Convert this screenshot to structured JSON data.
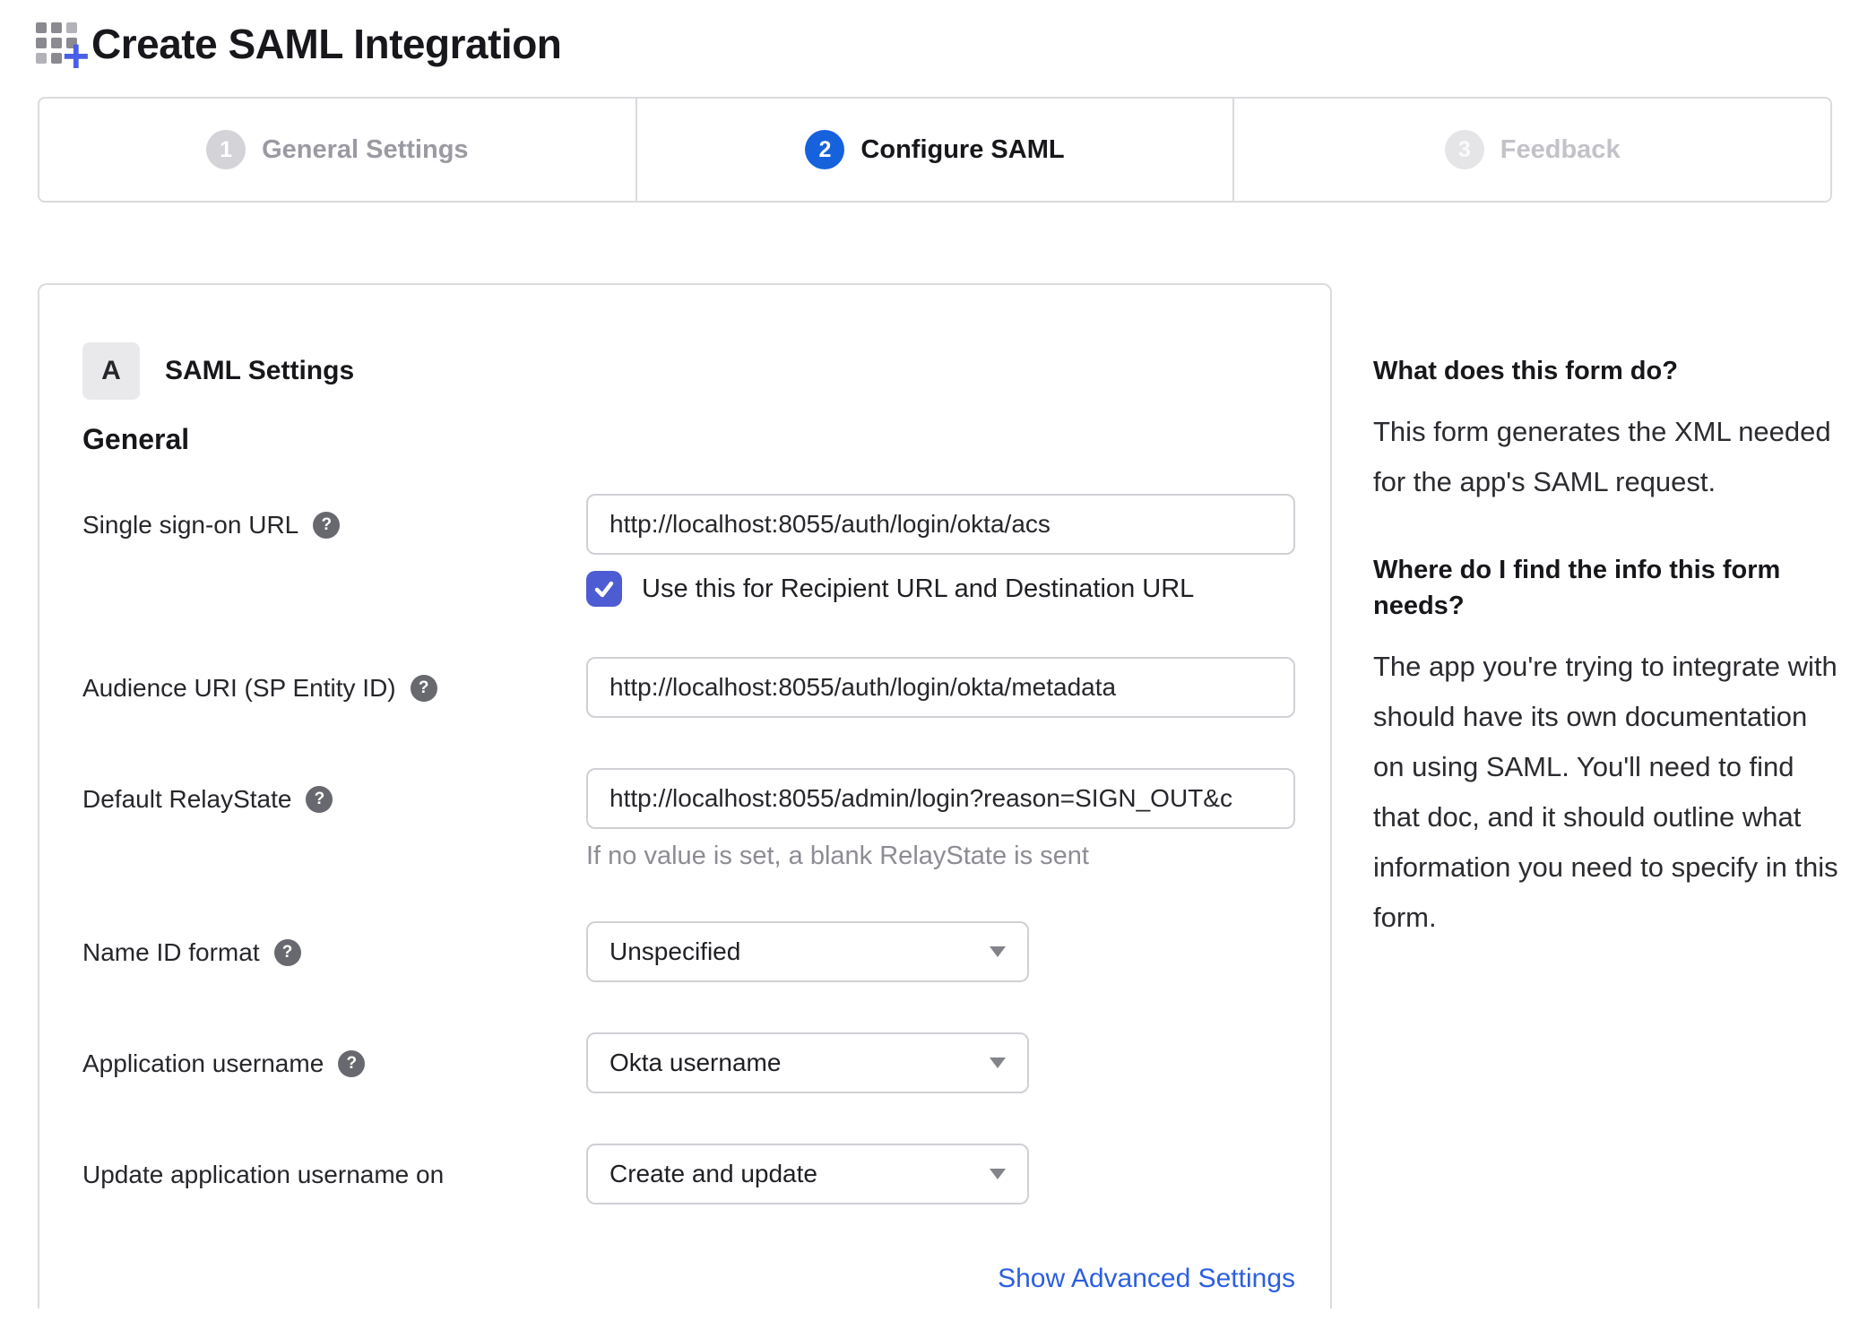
{
  "page": {
    "title": "Create SAML Integration",
    "icon": "app-grid-plus-icon"
  },
  "stepper": {
    "steps": [
      {
        "number": "1",
        "label": "General Settings",
        "state": "done"
      },
      {
        "number": "2",
        "label": "Configure SAML",
        "state": "active"
      },
      {
        "number": "3",
        "label": "Feedback",
        "state": "future"
      }
    ]
  },
  "form": {
    "section_badge": "A",
    "section_title": "SAML Settings",
    "group_title": "General",
    "fields": {
      "sso_url": {
        "label": "Single sign-on URL",
        "value": "http://localhost:8055/auth/login/okta/acs",
        "has_help_icon": true
      },
      "sso_checkbox": {
        "label": "Use this for Recipient URL and Destination URL",
        "checked": true
      },
      "audience_uri": {
        "label": "Audience URI (SP Entity ID)",
        "value": "http://localhost:8055/auth/login/okta/metadata",
        "has_help_icon": true
      },
      "default_relay_state": {
        "label": "Default RelayState",
        "value": "http://localhost:8055/admin/login?reason=SIGN_OUT&c",
        "helper": "If no value is set, a blank RelayState is sent",
        "has_help_icon": true
      },
      "name_id_format": {
        "label": "Name ID format",
        "value": "Unspecified",
        "has_help_icon": true
      },
      "application_username": {
        "label": "Application username",
        "value": "Okta username",
        "has_help_icon": true
      },
      "update_app_username": {
        "label": "Update application username on",
        "value": "Create and update",
        "has_help_icon": false
      }
    },
    "advanced_link": "Show Advanced Settings"
  },
  "sidebar": {
    "sections": [
      {
        "heading": "What does this form do?",
        "body": "This form generates the XML needed for the app's SAML request."
      },
      {
        "heading": "Where do I find the info this form needs?",
        "body": "The app you're trying to integrate with should have its own documentation on using SAML. You'll need to find that doc, and it should outline what information you need to specify in this form."
      }
    ]
  },
  "colors": {
    "active_step_blue": "#1662dd",
    "checkbox_indigo": "#4d5cd2",
    "link_blue": "#2c5fe0",
    "plus_icon_blue": "#4a5fe8",
    "border_gray": "#dcdcdf",
    "muted_text": "#8c8c94"
  }
}
